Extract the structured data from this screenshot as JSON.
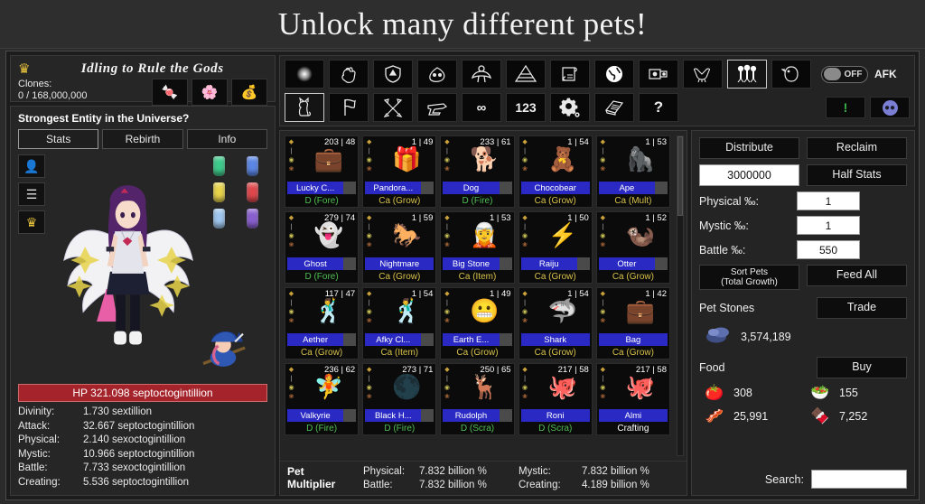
{
  "banner": {
    "title": "Unlock many different pets!"
  },
  "game": {
    "title": "Idling to Rule the Gods",
    "crown_icon": "crown-icon",
    "clones_label": "Clones:",
    "clones_value": "0 / 168,000,000",
    "clone_icons": [
      "candy-icon",
      "flower-icon",
      "gold-icon"
    ]
  },
  "character": {
    "heading": "Strongest Entity in the Universe?",
    "tabs": [
      {
        "label": "Stats",
        "active": true
      },
      {
        "label": "Rebirth",
        "active": false
      },
      {
        "label": "Info",
        "active": false
      }
    ],
    "side_buttons": [
      "profile-icon",
      "menu-icon",
      "crown-icon"
    ],
    "gems": [
      "#3cc98a",
      "#5b86e5",
      "#e8d34a",
      "#e0474c",
      "#9ec6ee",
      "#8a5fd0"
    ],
    "hp": "HP 321.098 septoctogintillion",
    "stats": [
      {
        "label": "Divinity:",
        "value": "1.730 sextillion"
      },
      {
        "label": "Attack:",
        "value": "32.667 septoctogintillion"
      },
      {
        "label": "Physical:",
        "value": "2.140 sexoctogintillion"
      },
      {
        "label": "Mystic:",
        "value": "10.966 septoctogintillion"
      },
      {
        "label": "Battle:",
        "value": "7.733 sexoctogintillion"
      },
      {
        "label": "Creating:",
        "value": "5.536 septoctogintillion"
      }
    ]
  },
  "toolbar": {
    "row1": [
      {
        "icon": "glow-orb-icon",
        "active": false
      },
      {
        "icon": "fist-icon",
        "active": false
      },
      {
        "icon": "shield-icon",
        "active": false
      },
      {
        "icon": "slime-icon",
        "active": false
      },
      {
        "icon": "person-icon",
        "active": false
      },
      {
        "icon": "pyramid-icon",
        "active": false
      },
      {
        "icon": "scroll-icon",
        "active": false
      },
      {
        "icon": "globe-icon",
        "active": false
      },
      {
        "icon": "device-icon",
        "active": false
      },
      {
        "icon": "dragon-icon",
        "active": false
      },
      {
        "icon": "three-figures-icon",
        "active": true
      },
      {
        "icon": "bird-icon",
        "active": false
      }
    ],
    "row2": [
      {
        "icon": "cat-icon",
        "active": true
      },
      {
        "icon": "flag-icon",
        "active": false
      },
      {
        "icon": "crossed-swords-icon",
        "active": false
      },
      {
        "icon": "anvil-icon",
        "active": false
      },
      {
        "icon": "infinity-icon",
        "label": "∞",
        "active": false
      },
      {
        "icon": "numbers-icon",
        "label": "123",
        "active": false
      },
      {
        "icon": "gear-icon",
        "active": false
      },
      {
        "icon": "book-icon",
        "active": false
      },
      {
        "icon": "question-icon",
        "label": "?",
        "active": false
      }
    ],
    "afk": {
      "state": "OFF",
      "label": "AFK"
    },
    "alert_icon": "exclamation-icon",
    "discord_icon": "discord-icon"
  },
  "pets": [
    {
      "level": "203 | 48",
      "name": "Lucky C...",
      "type": "D (Fore)",
      "type_color": "#4fbf52",
      "art": "💼",
      "nub": true
    },
    {
      "level": "1 | 49",
      "name": "Pandora...",
      "type": "Ca (Grow)",
      "type_color": "#d6c14a",
      "art": "🎁",
      "nub": true
    },
    {
      "level": "233 | 61",
      "name": "Dog",
      "type": "D (Fire)",
      "type_color": "#4fbf52",
      "art": "🐕",
      "nub": true
    },
    {
      "level": "1 | 54",
      "name": "Chocobear",
      "type": "Ca (Grow)",
      "type_color": "#d6c14a",
      "art": "🧸",
      "nub": false
    },
    {
      "level": "1 | 53",
      "name": "Ape",
      "type": "Ca (Mult)",
      "type_color": "#d6c14a",
      "art": "🦍",
      "nub": true
    },
    {
      "level": "279 | 74",
      "name": "Ghost",
      "type": "D (Fore)",
      "type_color": "#4fbf52",
      "art": "👻",
      "nub": true
    },
    {
      "level": "1 | 59",
      "name": "Nightmare",
      "type": "Ca (Grow)",
      "type_color": "#d6c14a",
      "art": "🐎",
      "nub": false
    },
    {
      "level": "1 | 53",
      "name": "Big Stone",
      "type": "Ca (Item)",
      "type_color": "#d6c14a",
      "art": "🧝",
      "nub": true
    },
    {
      "level": "1 | 50",
      "name": "Raiju",
      "type": "Ca (Grow)",
      "type_color": "#d6c14a",
      "art": "⚡",
      "nub": true
    },
    {
      "level": "1 | 52",
      "name": "Otter",
      "type": "Ca (Grow)",
      "type_color": "#d6c14a",
      "art": "🦦",
      "nub": true
    },
    {
      "level": "117 | 47",
      "name": "Aether",
      "type": "Ca (Grow)",
      "type_color": "#d6c14a",
      "art": "🕺",
      "nub": true
    },
    {
      "level": "1 | 54",
      "name": "Afky Cl...",
      "type": "Ca (Item)",
      "type_color": "#d6c14a",
      "art": "🕺",
      "nub": true
    },
    {
      "level": "1 | 49",
      "name": "Earth E...",
      "type": "Ca (Grow)",
      "type_color": "#d6c14a",
      "art": "😬",
      "nub": true
    },
    {
      "level": "1 | 54",
      "name": "Shark",
      "type": "Ca (Grow)",
      "type_color": "#d6c14a",
      "art": "🦈",
      "nub": false
    },
    {
      "level": "1 | 42",
      "name": "Bag",
      "type": "Ca (Grow)",
      "type_color": "#d6c14a",
      "art": "💼",
      "nub": false
    },
    {
      "level": "236 | 62",
      "name": "Valkyrie",
      "type": "D (Fire)",
      "type_color": "#4fbf52",
      "art": "🧚",
      "nub": true
    },
    {
      "level": "273 | 71",
      "name": "Black H...",
      "type": "D (Fire)",
      "type_color": "#4fbf52",
      "art": "🌑",
      "nub": true
    },
    {
      "level": "250 | 65",
      "name": "Rudolph",
      "type": "D (Scra)",
      "type_color": "#4fbf52",
      "art": "🦌",
      "nub": true
    },
    {
      "level": "217 | 58",
      "name": "Roni",
      "type": "D (Scra)",
      "type_color": "#4fbf52",
      "art": "🐙",
      "nub": false
    },
    {
      "level": "217 | 58",
      "name": "Almi",
      "type": "Crafting",
      "type_color": "#ffffff",
      "art": "🐙",
      "nub": false
    }
  ],
  "multiplier": {
    "title": "Pet Multiplier",
    "rows": [
      {
        "label": "Physical:",
        "value": "7.832 billion %",
        "label2": "Mystic:",
        "value2": "7.832 billion %"
      },
      {
        "label": "Battle:",
        "value": "7.832 billion %",
        "label2": "Creating:",
        "value2": "4.189 billion %"
      }
    ]
  },
  "controls": {
    "distribute": "Distribute",
    "reclaim": "Reclaim",
    "amount_value": "3000000",
    "half_stats": "Half Stats",
    "percents": [
      {
        "label": "Physical ‰:",
        "value": "1"
      },
      {
        "label": "Mystic ‰:",
        "value": "1"
      },
      {
        "label": "Battle ‰:",
        "value": "550"
      }
    ],
    "sort_pets_line1": "Sort Pets",
    "sort_pets_line2": "(Total Growth)",
    "feed_all": "Feed All",
    "pet_stones_label": "Pet Stones",
    "trade": "Trade",
    "stone_icon": "pet-stone-icon",
    "stone_count": "3,574,189",
    "food_label": "Food",
    "buy": "Buy",
    "foods": [
      {
        "icon": "🍅",
        "count": "308"
      },
      {
        "icon": "🥗",
        "count": "155"
      },
      {
        "icon": "🥓",
        "count": "25,991"
      },
      {
        "icon": "🍫",
        "count": "7,252"
      }
    ],
    "search_label": "Search:",
    "search_value": ""
  }
}
